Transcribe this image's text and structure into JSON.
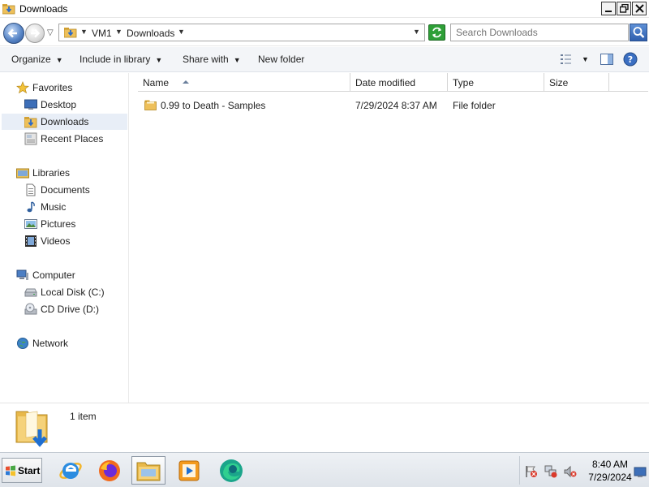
{
  "window": {
    "title": "Downloads"
  },
  "address": {
    "crumbs": [
      "VM1",
      "Downloads"
    ],
    "search_placeholder": "Search Downloads"
  },
  "commandbar": {
    "organize": "Organize",
    "include_in_library": "Include in library",
    "share_with": "Share with",
    "new_folder": "New folder"
  },
  "navpane": {
    "favorites": {
      "label": "Favorites",
      "items": [
        "Desktop",
        "Downloads",
        "Recent Places"
      ]
    },
    "libraries": {
      "label": "Libraries",
      "items": [
        "Documents",
        "Music",
        "Pictures",
        "Videos"
      ]
    },
    "computer": {
      "label": "Computer",
      "items": [
        "Local Disk (C:)",
        "CD Drive (D:)"
      ]
    },
    "network": {
      "label": "Network"
    }
  },
  "columns": [
    "Name",
    "Date modified",
    "Type",
    "Size"
  ],
  "files": [
    {
      "name": "0.99 to Death - Samples",
      "date_modified": "7/29/2024 8:37 AM",
      "type": "File folder",
      "size": ""
    }
  ],
  "details": {
    "count": "1 item"
  },
  "taskbar": {
    "start_label": "Start",
    "apps": [
      "internet-explorer-icon",
      "firefox-icon",
      "explorer-icon",
      "media-player-icon",
      "edge-icon"
    ],
    "clock": {
      "time": "8:40 AM",
      "date": "7/29/2024"
    }
  },
  "colors": {
    "selection": "#e8eef7",
    "folder": "#e8b84a",
    "start_green": "#2e9f37"
  }
}
